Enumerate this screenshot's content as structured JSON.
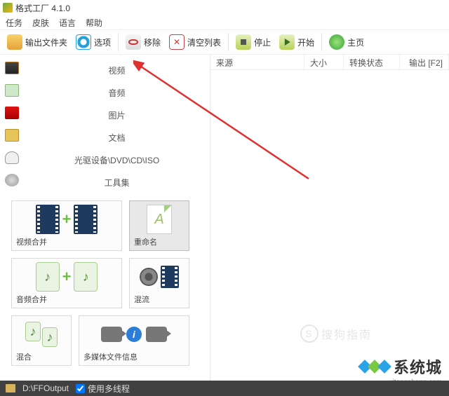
{
  "app": {
    "title": "格式工厂 4.1.0"
  },
  "menu": {
    "task": "任务",
    "skin": "皮肤",
    "lang": "语言",
    "help": "帮助"
  },
  "toolbar": {
    "output_folder": "输出文件夹",
    "options": "选项",
    "remove": "移除",
    "clear": "清空列表",
    "stop": "停止",
    "start": "开始",
    "home": "主页"
  },
  "categories": {
    "video": "视频",
    "audio": "音频",
    "picture": "图片",
    "document": "文档",
    "optical": "光驱设备\\DVD\\CD\\ISO",
    "tools": "工具集"
  },
  "tiles": {
    "video_merge": "视频合并",
    "rename": "重命名",
    "audio_merge": "音频合并",
    "mux": "混流",
    "mix": "混合",
    "media_info": "多媒体文件信息"
  },
  "grid": {
    "source": "来源",
    "size": "大小",
    "convert_state": "转换状态",
    "output": "输出 [F2]"
  },
  "status": {
    "output_path": "D:\\FFOutput",
    "multithread": "使用多线程"
  },
  "watermark": {
    "sogou": "搜狗指南",
    "xitongcheng": "系统城",
    "xtc_url": "xitongcheng.com"
  }
}
